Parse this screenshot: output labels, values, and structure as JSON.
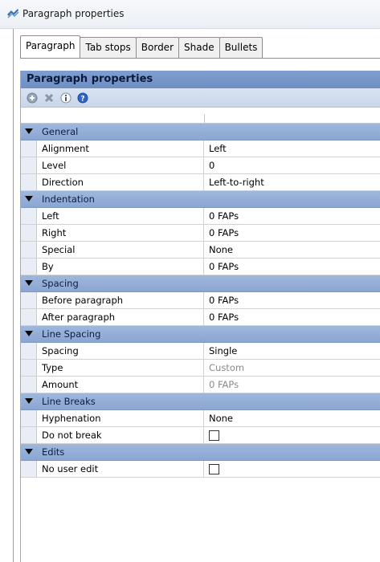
{
  "window": {
    "title": "Paragraph properties"
  },
  "tabs": [
    {
      "label": "Paragraph",
      "active": true
    },
    {
      "label": "Tab stops",
      "active": false
    },
    {
      "label": "Border",
      "active": false
    },
    {
      "label": "Shade",
      "active": false
    },
    {
      "label": "Bullets",
      "active": false
    }
  ],
  "panel": {
    "header": "Paragraph properties",
    "toolbar_icons": [
      "add-icon",
      "delete-icon",
      "info-icon",
      "help-icon"
    ]
  },
  "grid": {
    "general": {
      "label": "General",
      "alignment": {
        "key": "Alignment",
        "value": "Left"
      },
      "level": {
        "key": "Level",
        "value": "0"
      },
      "direction": {
        "key": "Direction",
        "value": "Left-to-right"
      }
    },
    "indentation": {
      "label": "Indentation",
      "left": {
        "key": "Left",
        "value": "0 FAPs"
      },
      "right": {
        "key": "Right",
        "value": "0 FAPs"
      },
      "special": {
        "key": "Special",
        "value": "None"
      },
      "by": {
        "key": "By",
        "value": "0 FAPs"
      }
    },
    "spacing": {
      "label": "Spacing",
      "before": {
        "key": "Before paragraph",
        "value": "0 FAPs"
      },
      "after": {
        "key": "After paragraph",
        "value": "0 FAPs"
      }
    },
    "line_spacing": {
      "label": "Line Spacing",
      "spacing": {
        "key": "Spacing",
        "value": "Single"
      },
      "type": {
        "key": "Type",
        "value": "Custom"
      },
      "amount": {
        "key": "Amount",
        "value": "0 FAPs"
      }
    },
    "line_breaks": {
      "label": "Line Breaks",
      "hyphenation": {
        "key": "Hyphenation",
        "value": "None"
      },
      "do_not_break": {
        "key": "Do not break",
        "checked": false
      }
    },
    "edits": {
      "label": "Edits",
      "no_user_edit": {
        "key": "No user edit",
        "checked": false
      }
    }
  },
  "colors": {
    "header": "#6f8fc4",
    "category": "#8aa6d3",
    "disabled_text": "#8a8a8a"
  }
}
